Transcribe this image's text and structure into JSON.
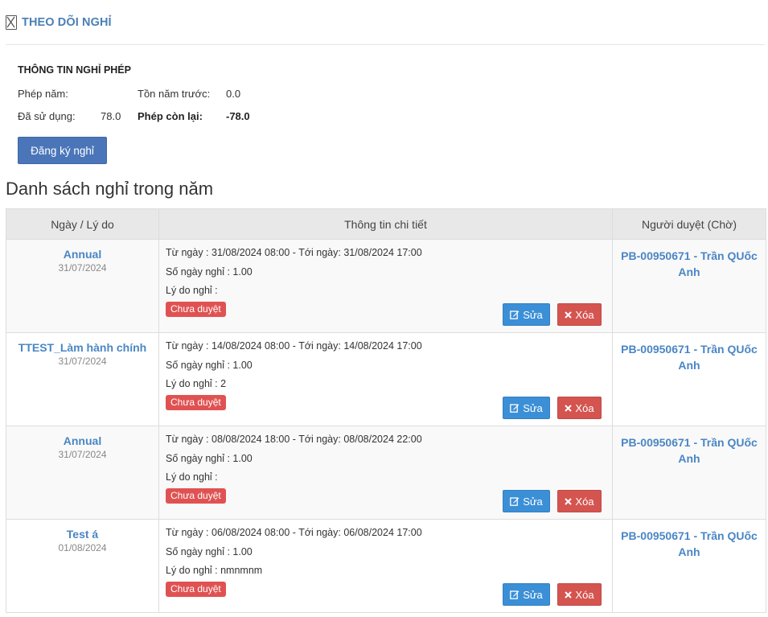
{
  "header": {
    "title": "THEO DÕI NGHỈ",
    "icon": "broken-image-icon"
  },
  "info": {
    "title": "THÔNG TIN NGHỈ PHÉP",
    "annual_label": "Phép năm:",
    "annual_value": "",
    "prev_year_label": "Tồn năm trước:",
    "prev_year_value": "0.0",
    "used_label": "Đã sử dụng:",
    "used_value": "78.0",
    "remaining_label": "Phép còn lại:",
    "remaining_value": "-78.0"
  },
  "register_button": "Đăng ký nghỉ",
  "list_title": "Danh sách nghỉ trong năm",
  "table": {
    "headers": [
      "Ngày / Lý do",
      "Thông tin chi tiết",
      "Người duyệt (Chờ)"
    ],
    "rows": [
      {
        "reason": "Annual",
        "date": "31/07/2024",
        "range": "Từ ngày : 31/08/2024 08:00 - Tới ngày: 31/08/2024 17:00",
        "days": "Số ngày nghỉ : 1.00",
        "note": "Lý do nghỉ :",
        "status": "Chưa duyệt",
        "approver": "PB-00950671 - Trần QUốc Anh"
      },
      {
        "reason": "TTEST_Làm hành chính",
        "date": "31/07/2024",
        "range": "Từ ngày : 14/08/2024 08:00 - Tới ngày: 14/08/2024 17:00",
        "days": "Số ngày nghỉ : 1.00",
        "note": "Lý do nghỉ : 2",
        "status": "Chưa duyệt",
        "approver": "PB-00950671 - Trần QUốc Anh"
      },
      {
        "reason": "Annual",
        "date": "31/07/2024",
        "range": "Từ ngày : 08/08/2024 18:00 - Tới ngày: 08/08/2024 22:00",
        "days": "Số ngày nghỉ : 1.00",
        "note": "Lý do nghỉ :",
        "status": "Chưa duyệt",
        "approver": "PB-00950671 - Trần QUốc Anh"
      },
      {
        "reason": "Test á",
        "date": "01/08/2024",
        "range": "Từ ngày : 06/08/2024 08:00 - Tới ngày: 06/08/2024 17:00",
        "days": "Số ngày nghỉ : 1.00",
        "note": "Lý do nghỉ : nmnmnm",
        "status": "Chưa duyệt",
        "approver": "PB-00950671 - Trần QUốc Anh"
      }
    ],
    "edit_label": "Sửa",
    "delete_label": "Xóa",
    "edit_icon": "edit-icon",
    "delete_icon": "close-icon"
  },
  "colors": {
    "link": "#4a86c4",
    "primary_button": "#4a76b9",
    "edit_button": "#3b8fd6",
    "delete_button": "#d45450",
    "badge": "#e05252"
  }
}
